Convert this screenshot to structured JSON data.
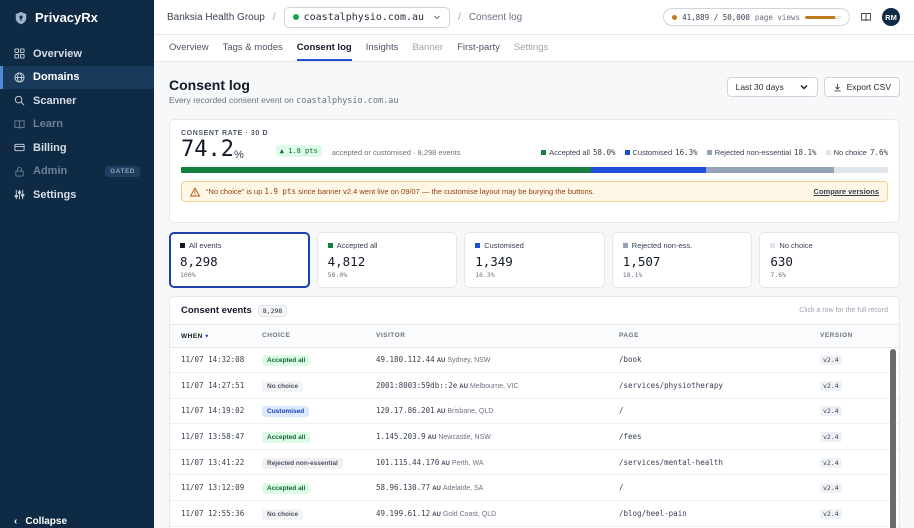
{
  "brand": {
    "name": "PrivacyRx"
  },
  "sidebar": {
    "items": [
      {
        "label": "Overview",
        "icon": "grid-icon",
        "state": "normal"
      },
      {
        "label": "Domains",
        "icon": "globe-icon",
        "state": "active"
      },
      {
        "label": "Scanner",
        "icon": "search-icon",
        "state": "normal"
      },
      {
        "label": "Learn",
        "icon": "book-icon",
        "state": "muted"
      },
      {
        "label": "Billing",
        "icon": "card-icon",
        "state": "normal"
      },
      {
        "label": "Admin",
        "icon": "lock-icon",
        "state": "muted",
        "badge": "GATED"
      },
      {
        "label": "Settings",
        "icon": "sliders-icon",
        "state": "normal"
      }
    ],
    "collapse_label": "Collapse"
  },
  "topbar": {
    "org": "Banksia Health Group",
    "domain": "coastalphysio.com.au",
    "page": "Consent log",
    "usage_text": "41,889 / 50,000",
    "usage_unit": "page views",
    "usage_fraction": 0.84,
    "avatar": "RM"
  },
  "tabs": [
    {
      "label": "Overview",
      "state": "normal"
    },
    {
      "label": "Tags & modes",
      "state": "normal"
    },
    {
      "label": "Consent log",
      "state": "active"
    },
    {
      "label": "Insights",
      "state": "normal"
    },
    {
      "label": "Banner",
      "state": "disabled"
    },
    {
      "label": "First-party",
      "state": "normal"
    },
    {
      "label": "Settings",
      "state": "disabled"
    }
  ],
  "header": {
    "title": "Consent log",
    "subtitle_prefix": "Every recorded consent event on",
    "subtitle_domain": "coastalphysio.com.au",
    "range": "Last 30 days",
    "export": "Export CSV"
  },
  "rate": {
    "label": "CONSENT RATE · 30 D",
    "value": "74.2",
    "unit": "%",
    "delta": "▲ 1.8 pts",
    "desc": "accepted or customised · 8,298 events",
    "legend": [
      {
        "label": "Accepted all",
        "pct": "58.0%",
        "value": 58.0,
        "color": "#15803d"
      },
      {
        "label": "Customised",
        "pct": "16.3%",
        "value": 16.3,
        "color": "#1d4ed8"
      },
      {
        "label": "Rejected non-essential",
        "pct": "18.1%",
        "value": 18.1,
        "color": "#94a3b8"
      },
      {
        "label": "No choice",
        "pct": "7.6%",
        "value": 7.6,
        "color": "#dfe3ea"
      }
    ]
  },
  "alert": {
    "text_a": "“No choice” is up",
    "text_b": "1.9 pts",
    "text_c": "since banner v2.4 went live on 09/07 — the customise layout may be burying the buttons.",
    "link": "Compare versions"
  },
  "stats": [
    {
      "label": "All events",
      "value": "8,298",
      "pct": "100%",
      "color": "#111827",
      "active": true
    },
    {
      "label": "Accepted all",
      "value": "4,812",
      "pct": "58.0%",
      "color": "#15803d"
    },
    {
      "label": "Customised",
      "value": "1,349",
      "pct": "16.3%",
      "color": "#1d4ed8"
    },
    {
      "label": "Rejected non-ess.",
      "value": "1,507",
      "pct": "18.1%",
      "color": "#94a3b8"
    },
    {
      "label": "No choice",
      "value": "630",
      "pct": "7.6%",
      "color": "#dfe3ea"
    }
  ],
  "events": {
    "title": "Consent events",
    "count": "8,298",
    "hint": "Click a row for the full record",
    "columns": [
      "WHEN",
      "CHOICE",
      "VISITOR",
      "PAGE",
      "VERSION"
    ],
    "rows": [
      {
        "when": "11/07 14:32:08",
        "choice": "Accepted all",
        "kind": "acc",
        "ip": "49.180.112.44",
        "cc": "AU",
        "loc": "Sydney, NSW",
        "page": "/book",
        "ver": "v2.4"
      },
      {
        "when": "11/07 14:27:51",
        "choice": "No choice",
        "kind": "none",
        "ip": "2001:8003:59db::2e",
        "cc": "AU",
        "loc": "Melbourne, VIC",
        "page": "/services/physiotherapy",
        "ver": "v2.4"
      },
      {
        "when": "11/07 14:19:02",
        "choice": "Customised",
        "kind": "cust",
        "ip": "120.17.86.201",
        "cc": "AU",
        "loc": "Brisbane, QLD",
        "page": "/",
        "ver": "v2.4"
      },
      {
        "when": "11/07 13:58:47",
        "choice": "Accepted all",
        "kind": "acc",
        "ip": "1.145.203.9",
        "cc": "AU",
        "loc": "Newcastle, NSW",
        "page": "/fees",
        "ver": "v2.4"
      },
      {
        "when": "11/07 13:41:22",
        "choice": "Rejected non-essential",
        "kind": "rej",
        "ip": "101.115.44.170",
        "cc": "AU",
        "loc": "Perth, WA",
        "page": "/services/mental-health",
        "ver": "v2.4"
      },
      {
        "when": "11/07 13:12:09",
        "choice": "Accepted all",
        "kind": "acc",
        "ip": "58.96.130.77",
        "cc": "AU",
        "loc": "Adelaide, SA",
        "page": "/",
        "ver": "v2.4"
      },
      {
        "when": "11/07 12:55:36",
        "choice": "No choice",
        "kind": "none",
        "ip": "49.199.61.12",
        "cc": "AU",
        "loc": "Gold Coast, QLD",
        "page": "/blog/heel-pain",
        "ver": "v2.4"
      }
    ]
  }
}
